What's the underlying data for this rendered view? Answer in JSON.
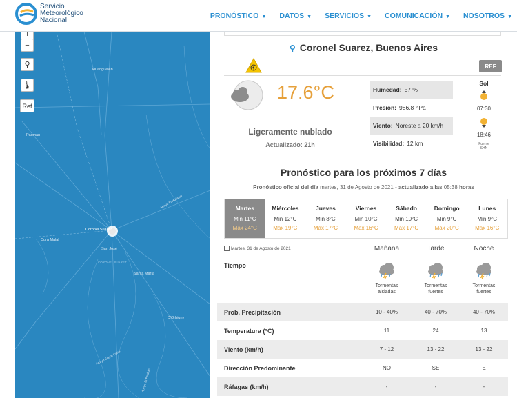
{
  "brand": {
    "line1": "Servicio",
    "line2": "Meteorológico",
    "line3": "Nacional"
  },
  "nav": [
    "PRONÓSTICO",
    "DATOS",
    "SERVICIOS",
    "COMUNICACIÓN",
    "NOSOTROS"
  ],
  "map": {
    "ref_label": "Ref",
    "places": [
      "Huanguelén",
      "Pasman",
      "Cura Malal",
      "Coronel Suárez",
      "San José",
      "CORONEL SUAREZ",
      "Santa María",
      "Arroyo El Huáscar",
      "D'Orbigny",
      "Arroyo Sauce Corto",
      "Arroyo El Perdido"
    ]
  },
  "location": "Coronel Suarez, Buenos Aires",
  "ref_button": "REF",
  "current": {
    "temperature": "17.6°C",
    "condition": "Ligeramente nublado",
    "updated": "Actualizado: 21h",
    "humidity_label": "Humedad:",
    "humidity": "57 %",
    "pressure_label": "Presión:",
    "pressure": "986.8 hPa",
    "wind_label": "Viento:",
    "wind": "Noreste a 20 km/h",
    "visibility_label": "Visibilidad:",
    "visibility": "12 km"
  },
  "sun": {
    "title": "Sol",
    "rise": "07:30",
    "set": "18:46",
    "source1": "Fuente",
    "source2": "SHN"
  },
  "forecast": {
    "title": "Pronóstico para los próximos 7 días",
    "sub_a": "Pronóstico oficial del día",
    "sub_b": "martes, 31 de Agosto de 2021",
    "sub_c": "- actualizado a las",
    "sub_d": "05:38",
    "sub_e": "horas",
    "days": [
      {
        "name": "Martes",
        "min": "Min 11°C",
        "max": "Máx 24°C"
      },
      {
        "name": "Miércoles",
        "min": "Min 12°C",
        "max": "Máx 19°C"
      },
      {
        "name": "Jueves",
        "min": "Min 8°C",
        "max": "Máx 17°C"
      },
      {
        "name": "Viernes",
        "min": "Min 10°C",
        "max": "Máx 16°C"
      },
      {
        "name": "Sábado",
        "min": "Min 10°C",
        "max": "Máx 17°C"
      },
      {
        "name": "Domingo",
        "min": "Min 9°C",
        "max": "Máx 20°C"
      },
      {
        "name": "Lunes",
        "min": "Min 9°C",
        "max": "Máx 16°C"
      }
    ]
  },
  "detail": {
    "date": "Martes, 31 de Agosto de 2021",
    "columns": [
      "Mañana",
      "Tarde",
      "Noche"
    ],
    "tiempo_label": "Tiempo",
    "weather": [
      {
        "l1": "Tormentas",
        "l2": "aisladas"
      },
      {
        "l1": "Tormentas",
        "l2": "fuertes"
      },
      {
        "l1": "Tormentas",
        "l2": "fuertes"
      }
    ],
    "rows": [
      {
        "label": "Prob. Precipitación",
        "values": [
          "10 - 40%",
          "40 - 70%",
          "40 - 70%"
        ]
      },
      {
        "label": "Temperatura (°C)",
        "values": [
          "11",
          "24",
          "13"
        ]
      },
      {
        "label": "Viento (km/h)",
        "values": [
          "7 - 12",
          "13 - 22",
          "13 - 22"
        ]
      },
      {
        "label": "Dirección Predominante",
        "values": [
          "NO",
          "SE",
          "E"
        ]
      },
      {
        "label": "Ráfagas (km/h)",
        "values": [
          "-",
          "-",
          "-"
        ]
      }
    ]
  }
}
